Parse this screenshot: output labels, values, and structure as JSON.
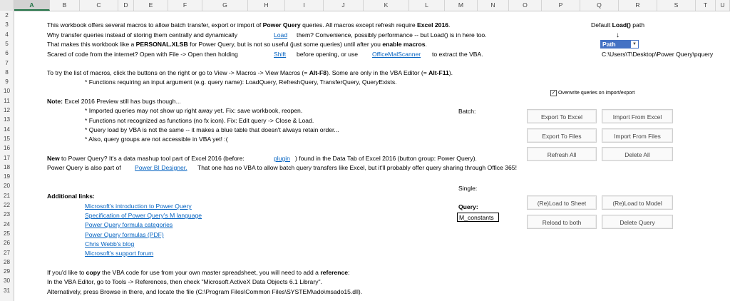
{
  "columns": [
    "A",
    "B",
    "C",
    "D",
    "E",
    "F",
    "G",
    "H",
    "I",
    "J",
    "K",
    "L",
    "M",
    "N",
    "O",
    "P",
    "Q",
    "R",
    "S",
    "T",
    "U"
  ],
  "selected_column": "A",
  "rows": [
    "2",
    "3",
    "4",
    "5",
    "6",
    "7",
    "8",
    "9",
    "10",
    "11",
    "12",
    "13",
    "14",
    "15",
    "16",
    "17",
    "18",
    "19",
    "20",
    "21",
    "22",
    "23",
    "24",
    "25",
    "26",
    "27",
    "28",
    "29",
    "30",
    "31"
  ],
  "sheet": {
    "r3": {
      "pre": "This workbook offers several macros to allow batch transfer, export or import of ",
      "b1": "Power Query",
      "mid": " queries. All macros except refresh require ",
      "b2": "Excel 2016",
      "post": "."
    },
    "r4": {
      "a": "Why transfer queries instead of storing them centrally and dynamically",
      "link": "Load",
      "b": "them? Convenience, possibly performance -- but Load() is in here too."
    },
    "r5": {
      "pre": "That makes this workbook like a ",
      "b1": "PERSONAL.XLSB",
      "mid": " for Power Query, but is not so useful (just some queries) until after you ",
      "b2": "enable macros",
      "post": "."
    },
    "r6": {
      "a": "Scared of code from the internet? Open with File -> Open then holding",
      "link1": "Shift",
      "b": "before opening, or use",
      "link2": "OfficeMalScanner",
      "c": "to extract the VBA."
    },
    "r8": {
      "pre": "To try the list of macros, click the buttons on the right or go to View -> Macros -> View Macros (= ",
      "b1": "Alt-F8",
      "mid": "). Some are only in the VBA Editor (= ",
      "b2": "Alt-F11",
      "post": ")."
    },
    "r9": "* Functions requiring an input argument (e.g. query name): LoadQuery, RefreshQuery, TransferQuery, QueryExists.",
    "r11": {
      "b": "Note:",
      "rest": " Excel 2016 Preview still has bugs though..."
    },
    "r12": "* Imported queries may not show up right away yet. Fix: save workbook, reopen.",
    "r13": "* Functions not recognized as functions (no fx icon). Fix: Edit query -> Close & Load.",
    "r14": "* Query load by VBA is not the same -- it makes a blue table that doesn't always retain order...",
    "r15": "* Also, query groups are not accessible in VBA yet! :(",
    "r17": {
      "b": "New",
      "a": " to Power Query? It's a data mashup tool part of Excel 2016 (before:",
      "link": "plugin",
      "c": ") found in the Data Tab of Excel 2016 (button group: Power Query)."
    },
    "r18": {
      "a": "Power Query is also part of",
      "link": "Power BI Designer.",
      "b": "That one has no VBA to allow batch query transfers like Excel, but it'll probably offer query sharing through Office 365!"
    },
    "r21": "Additional links:",
    "links": [
      "Microsoft's introduction to Power Query",
      "Specification of Power Query's M language",
      "Power Query formula categories",
      "Power Query formulas (PDF)",
      "Chris Webb's blog",
      "Microsoft's support forum"
    ],
    "r29": {
      "pre": "If you'd like to ",
      "b1": "copy",
      "mid": " the VBA code for use from your own master spreadsheet, you will need to add a ",
      "b2": "reference",
      "post": ":"
    },
    "r30": "In the VBA Editor, go to Tools -> References, then check \"Microsoft ActiveX Data Objects 6.1 Library\".",
    "r31": "Alternatively, press Browse in there, and locate the file (C:\\Program Files\\Common Files\\SYSTEM\\ado\\msado15.dll)."
  },
  "right_panel": {
    "default_path_pre": "Default ",
    "default_path_bold": "Load()",
    "default_path_post": " path",
    "arrow": "↓",
    "path_header": "Path",
    "dropdown_glyph": "▼",
    "path_value": "C:\\Users\\T\\Desktop\\Power Query\\pquery",
    "overwrite_checked": "✓",
    "overwrite_label": "Overwrite queries on import/export",
    "batch_label": "Batch:",
    "single_label": "Single:",
    "query_label": "Query:",
    "query_value": "M_constants",
    "buttons": {
      "export_to_excel": "Export To Excel",
      "import_from_excel": "Import From Excel",
      "export_to_files": "Export To Files",
      "import_from_files": "Import From Files",
      "refresh_all": "Refresh All",
      "delete_all": "Delete All",
      "reload_to_sheet": "(Re)Load to Sheet",
      "reload_to_model": "(Re)Load to Model",
      "reload_to_both": "Reload to both",
      "delete_query": "Delete Query"
    }
  }
}
